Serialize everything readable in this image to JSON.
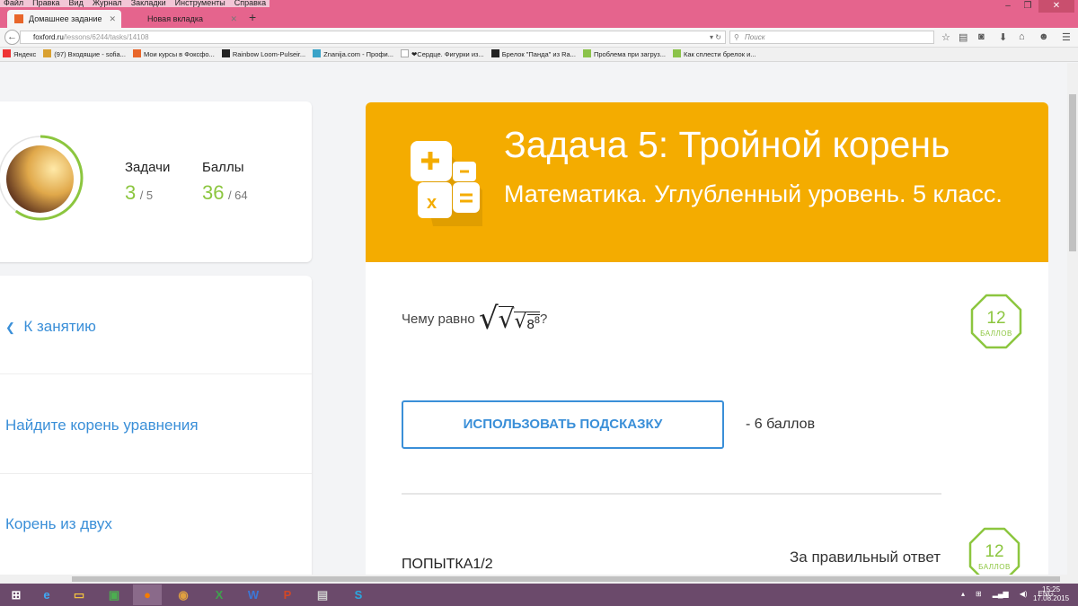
{
  "browser": {
    "menu": [
      "Файл",
      "Правка",
      "Вид",
      "Журнал",
      "Закладки",
      "Инструменты",
      "Справка"
    ],
    "tabs": [
      {
        "label": "Домашнее задание"
      },
      {
        "label": "Новая вкладка"
      }
    ],
    "url_domain": "foxford.ru",
    "url_path": "/lessons/6244/tasks/14108",
    "search_placeholder": "Поиск",
    "bookmarks": [
      "Яндекс",
      "(97) Входящие - sofia...",
      "Мои курсы в Фоксфо...",
      "Rainbow Loom-Pulseir...",
      "Znanija.com - Профи...",
      "❤Сердце. Фигурки из...",
      "Брелок \"Панда\" из Ra...",
      "Проблема при загруз...",
      "Как сплести брелок и..."
    ]
  },
  "profile": {
    "tasks_label": "Задачи",
    "tasks_done": "3",
    "tasks_total": "/ 5",
    "points_label": "Баллы",
    "points": "36",
    "points_total": "/ 64",
    "progress": 0.6
  },
  "nav": {
    "back": "К занятию",
    "items": [
      "Найдите корень уравнения",
      "Корень из двух"
    ]
  },
  "task": {
    "title": "Задача 5: Тройной корень",
    "subtitle": "Математика. Углубленный уровень. 5 класс.",
    "question_prefix": "Чему равно",
    "base": "8",
    "exponent": "8",
    "question_suffix": "?",
    "points": "12",
    "points_label": "баллов",
    "hint_button": "ИСПОЛЬЗОВАТЬ ПОДСКАЗКУ",
    "hint_cost": "- 6 баллов",
    "attempt": "ПОПЫТКА",
    "attempt_count": "1/2",
    "right_answer_label": "За правильный ответ",
    "right_points": "12",
    "right_points_label": "баллов"
  },
  "colors": {
    "accent": "#3a8fd8",
    "header": "#f4ac00",
    "green": "#8cc63f"
  },
  "taskbar": {
    "lang": "ENG",
    "time": "15:25",
    "date": "17.08.2015"
  }
}
